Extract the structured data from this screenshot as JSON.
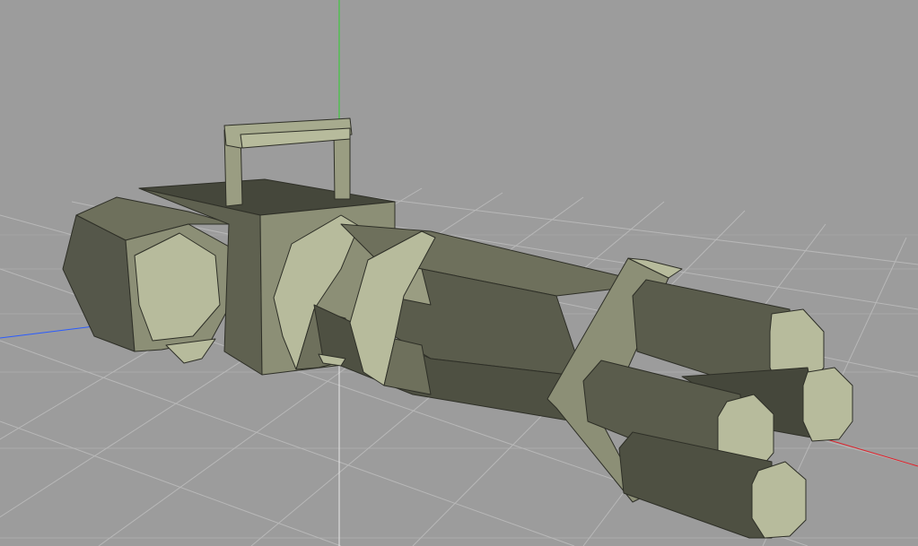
{
  "viewport": {
    "background": "#9c9c9c",
    "grid_color": "#b9b9b9",
    "axis_x_color": "#e0202a",
    "axis_y_color": "#2bd12b",
    "axis_z_color": "#2a5cff",
    "model": {
      "name": "minigun",
      "base_color": "#8c8f76",
      "light_color": "#b7bb9c",
      "dark_color": "#55574a",
      "darker_color": "#45473b",
      "edge_color": "#2e2f27"
    }
  }
}
